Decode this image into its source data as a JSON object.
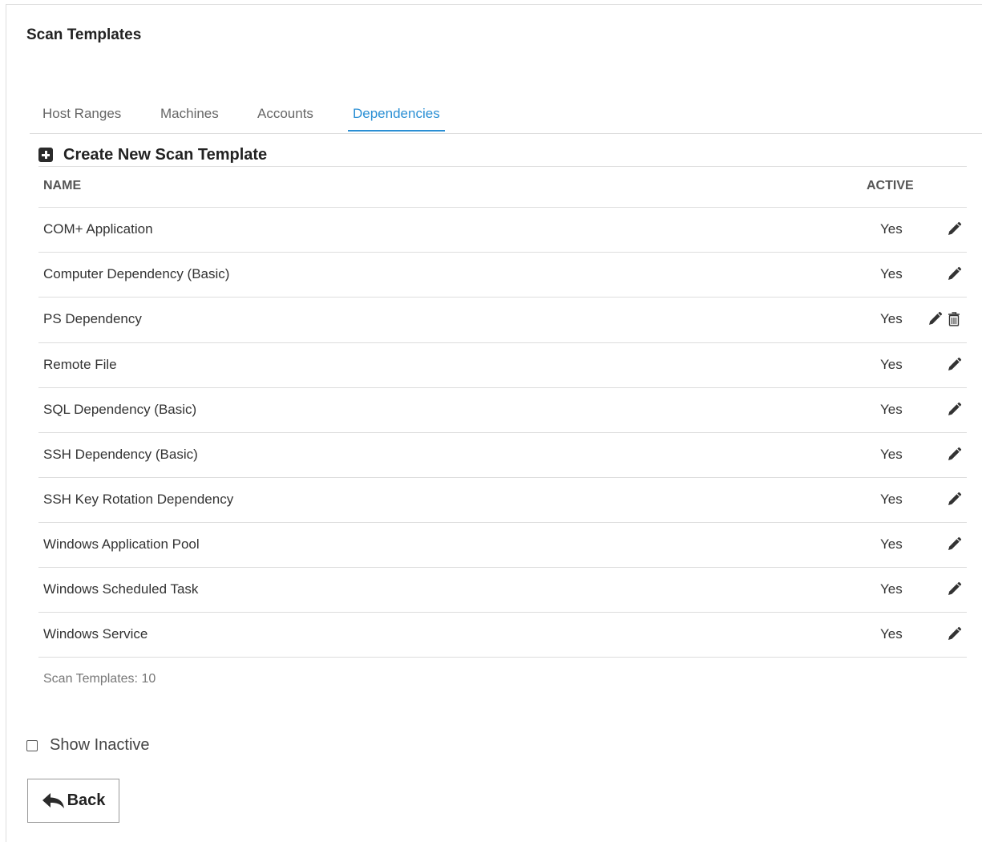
{
  "header": {
    "title": "Scan Templates"
  },
  "tabs": [
    {
      "label": "Host Ranges",
      "active": false
    },
    {
      "label": "Machines",
      "active": false
    },
    {
      "label": "Accounts",
      "active": false
    },
    {
      "label": "Dependencies",
      "active": true
    }
  ],
  "create": {
    "label": "Create New Scan Template",
    "icon": "plus-square-icon"
  },
  "table": {
    "columns": {
      "name": "NAME",
      "active": "ACTIVE"
    },
    "rows": [
      {
        "name": "COM+ Application",
        "active": "Yes",
        "actions": [
          "edit"
        ]
      },
      {
        "name": "Computer Dependency (Basic)",
        "active": "Yes",
        "actions": [
          "edit"
        ]
      },
      {
        "name": "PS Dependency",
        "active": "Yes",
        "actions": [
          "edit",
          "delete"
        ]
      },
      {
        "name": "Remote File",
        "active": "Yes",
        "actions": [
          "edit"
        ]
      },
      {
        "name": "SQL Dependency (Basic)",
        "active": "Yes",
        "actions": [
          "edit"
        ]
      },
      {
        "name": "SSH Dependency (Basic)",
        "active": "Yes",
        "actions": [
          "edit"
        ]
      },
      {
        "name": "SSH Key Rotation Dependency",
        "active": "Yes",
        "actions": [
          "edit"
        ]
      },
      {
        "name": "Windows Application Pool",
        "active": "Yes",
        "actions": [
          "edit"
        ]
      },
      {
        "name": "Windows Scheduled Task",
        "active": "Yes",
        "actions": [
          "edit"
        ]
      },
      {
        "name": "Windows Service",
        "active": "Yes",
        "actions": [
          "edit"
        ]
      }
    ]
  },
  "footer": {
    "count_text": "Scan Templates: 10"
  },
  "show_inactive": {
    "label": "Show Inactive",
    "checked": false
  },
  "back_button": {
    "label": "Back",
    "icon": "reply-arrow-icon"
  },
  "colors": {
    "accent": "#2a8fd4",
    "text": "#333333",
    "border": "#dddddd"
  }
}
